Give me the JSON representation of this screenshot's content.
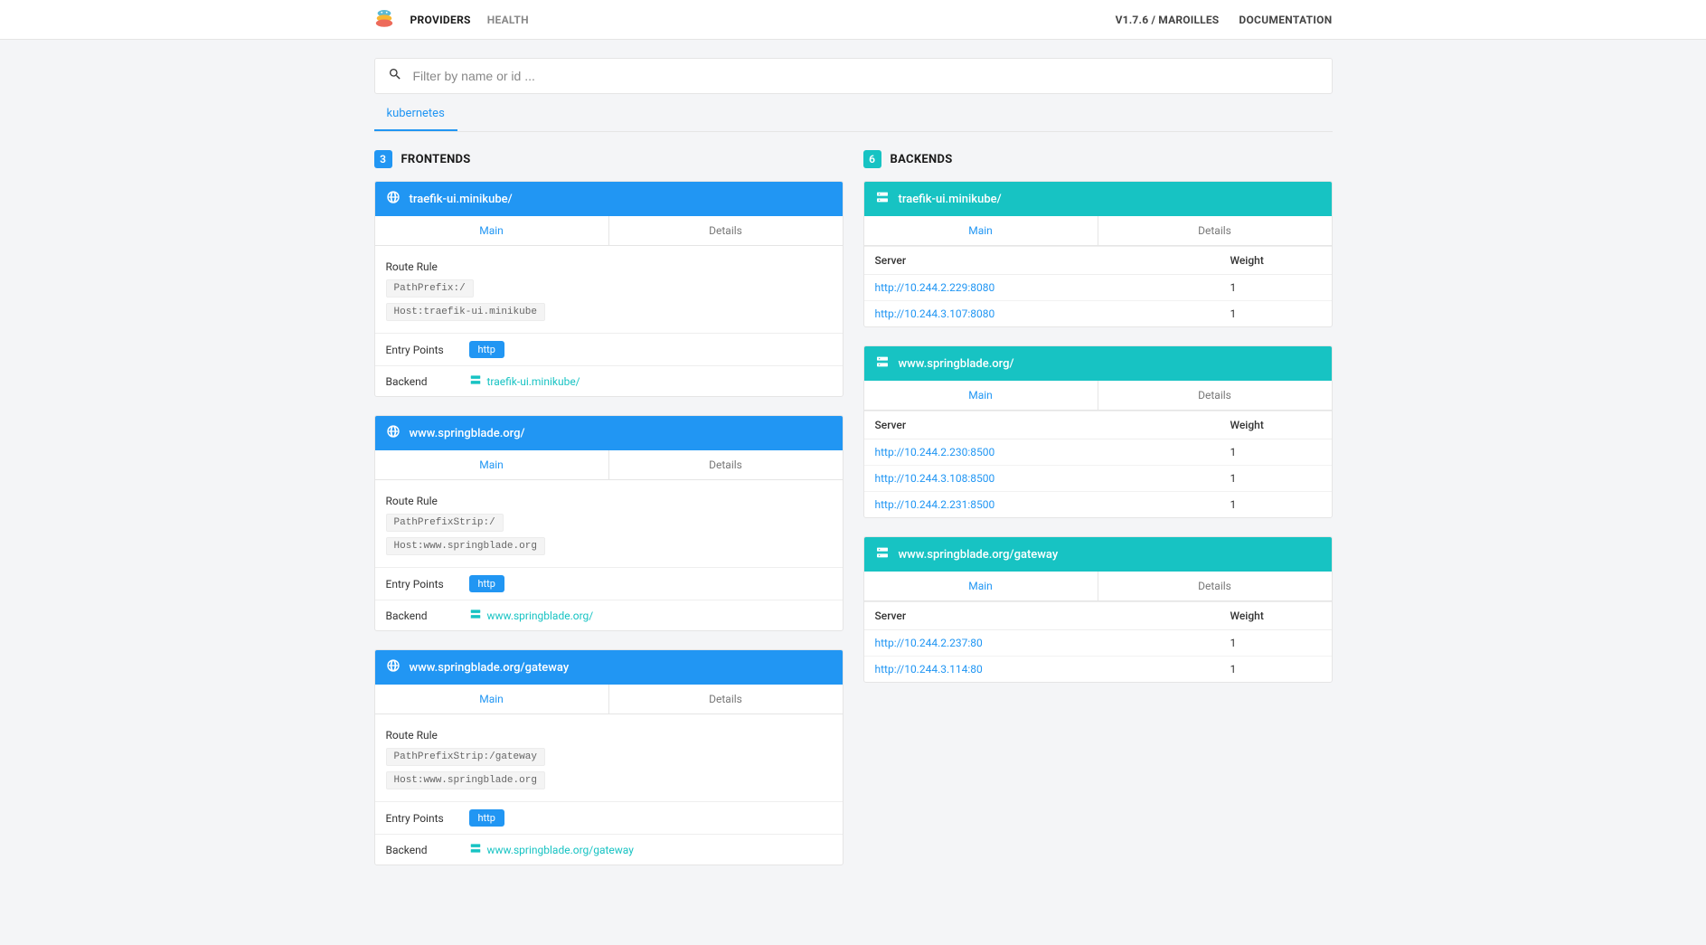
{
  "topbar": {
    "nav": {
      "providers": "PROVIDERS",
      "health": "HEALTH"
    },
    "version": "V1.7.6 / MAROILLES",
    "documentation": "DOCUMENTATION"
  },
  "search": {
    "placeholder": "Filter by name or id ..."
  },
  "providerTab": "kubernetes",
  "frontends": {
    "title": "FRONTENDS",
    "count": "3",
    "tabMain": "Main",
    "tabDetails": "Details",
    "labelRouteRule": "Route Rule",
    "labelEntryPoints": "Entry Points",
    "labelBackend": "Backend",
    "httpBadge": "http",
    "items": [
      {
        "title": "traefik-ui.minikube/",
        "rules": [
          "PathPrefix:/",
          "Host:traefik-ui.minikube"
        ],
        "backend": "traefik-ui.minikube/"
      },
      {
        "title": "www.springblade.org/",
        "rules": [
          "PathPrefixStrip:/",
          "Host:www.springblade.org"
        ],
        "backend": "www.springblade.org/"
      },
      {
        "title": "www.springblade.org/gateway",
        "rules": [
          "PathPrefixStrip:/gateway",
          "Host:www.springblade.org"
        ],
        "backend": "www.springblade.org/gateway"
      }
    ]
  },
  "backends": {
    "title": "BACKENDS",
    "count": "6",
    "tabMain": "Main",
    "tabDetails": "Details",
    "thServer": "Server",
    "thWeight": "Weight",
    "items": [
      {
        "title": "traefik-ui.minikube/",
        "servers": [
          {
            "url": "http://10.244.2.229:8080",
            "weight": "1"
          },
          {
            "url": "http://10.244.3.107:8080",
            "weight": "1"
          }
        ]
      },
      {
        "title": "www.springblade.org/",
        "servers": [
          {
            "url": "http://10.244.2.230:8500",
            "weight": "1"
          },
          {
            "url": "http://10.244.3.108:8500",
            "weight": "1"
          },
          {
            "url": "http://10.244.2.231:8500",
            "weight": "1"
          }
        ]
      },
      {
        "title": "www.springblade.org/gateway",
        "servers": [
          {
            "url": "http://10.244.2.237:80",
            "weight": "1"
          },
          {
            "url": "http://10.244.3.114:80",
            "weight": "1"
          }
        ]
      }
    ]
  }
}
